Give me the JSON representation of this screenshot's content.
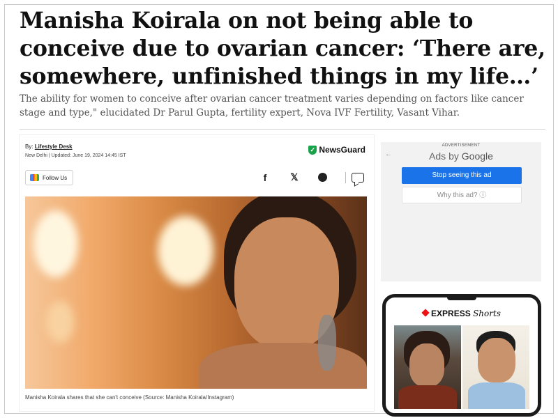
{
  "article": {
    "headline": "Manisha Koirala on not being able to conceive due to ovarian cancer: ‘There are, somewhere, unfinished things in my life…’",
    "dek": "The ability for women to conceive after ovarian cancer treatment varies depending on factors like cancer stage and type,\" elucidated Dr Parul Gupta, fertility expert, Nova IVF Fertility, Vasant Vihar.",
    "byline_prefix": "By:",
    "byline_author": "Lifestyle Desk",
    "dateline": "New Delhi | Updated: June 19, 2024 14:45 IST",
    "newsguard": "NewsGuard",
    "follow_label": "Follow Us",
    "caption": "Manisha Koirala shares that she can't conceive (Source: Manisha Koirala/Instagram)"
  },
  "share": {
    "facebook": "f",
    "x": "𝕏"
  },
  "ad": {
    "label": "ADVERTISEMENT",
    "ads_by": "Ads by",
    "google": "Google",
    "stop": "Stop seeing this ad",
    "why": "Why this ad? ⓘ",
    "back": "←"
  },
  "shorts": {
    "brand": "EXPRESS",
    "suffix": "Shorts"
  },
  "colors": {
    "primary_blue": "#1a73e8",
    "newsguard_green": "#18a24a",
    "express_red": "#e11"
  }
}
